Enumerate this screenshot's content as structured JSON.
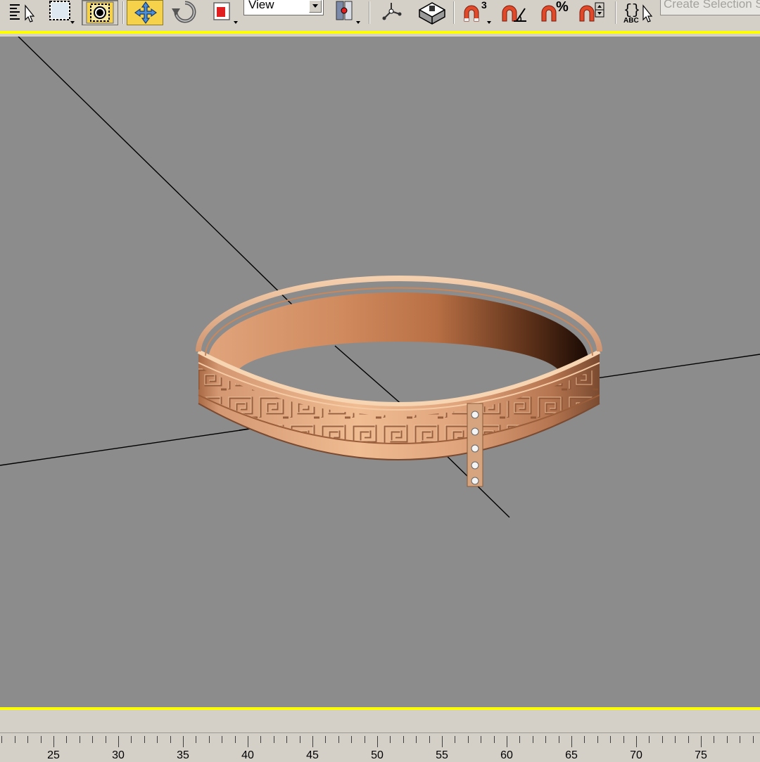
{
  "toolbar": {
    "view_dropdown": {
      "value": "View"
    },
    "selection_set": {
      "placeholder": "Create Selection Set"
    },
    "buttons": [
      {
        "icon": "select-by-name-icon"
      },
      {
        "icon": "rectangular-selection-region-icon"
      },
      {
        "icon": "window-crossing-icon"
      },
      {
        "icon": "select-and-move-icon",
        "active": true
      },
      {
        "icon": "select-and-rotate-icon"
      },
      {
        "icon": "select-and-scale-icon"
      },
      {
        "icon": "use-pivot-point-center-icon"
      },
      {
        "icon": "select-and-manipulate-icon"
      },
      {
        "icon": "keyboard-shortcut-override-icon"
      },
      {
        "icon": "snaps-toggle-icon"
      },
      {
        "icon": "angle-snap-toggle-icon"
      },
      {
        "icon": "percent-snap-toggle-icon"
      },
      {
        "icon": "spinner-snap-toggle-icon"
      },
      {
        "icon": "edit-named-selection-sets-icon"
      }
    ],
    "snap_label": "3",
    "percent_label": "%",
    "abc_label": "ABC"
  },
  "colors": {
    "accent_yellow": "#ffff00",
    "active_button": "#f5d24a",
    "viewport_bg": "#8c8c8c",
    "ring_copper": "#c98a5e"
  },
  "viewport": {
    "object": "ring-model"
  },
  "timeline": {
    "tick_labels": [
      "25",
      "30",
      "35",
      "40",
      "45",
      "50",
      "55",
      "60",
      "65",
      "70",
      "75"
    ]
  }
}
